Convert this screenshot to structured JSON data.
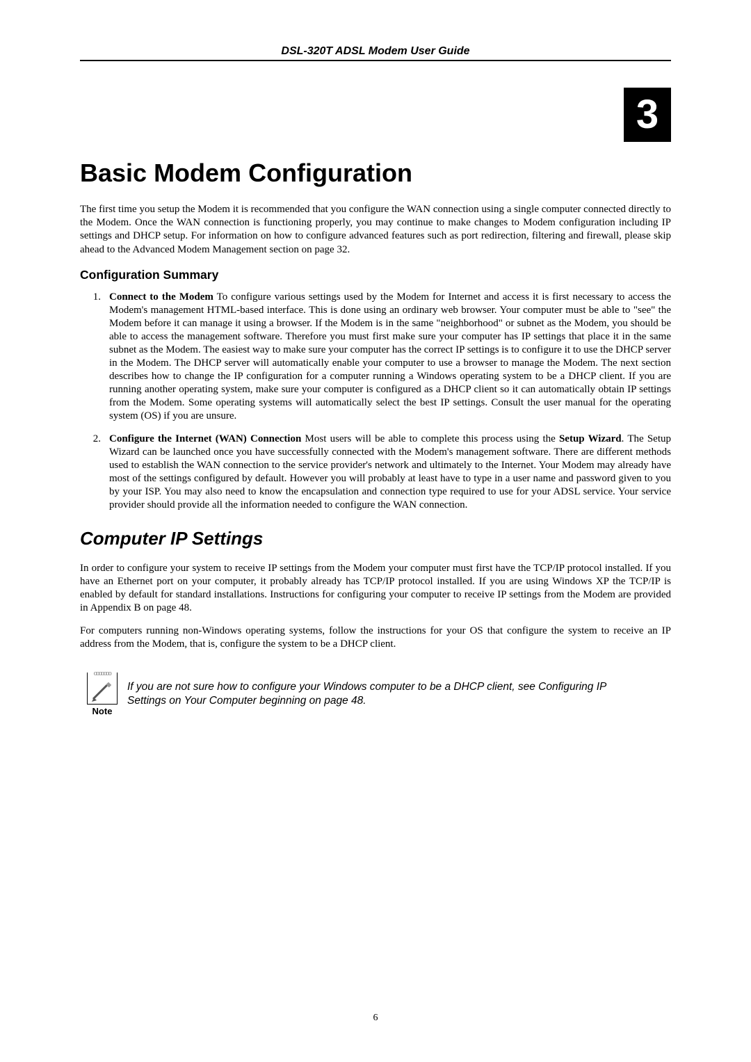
{
  "header": {
    "title": "DSL-320T ADSL Modem User Guide"
  },
  "chapter": {
    "number": "3",
    "heading": "Basic Modem Configuration",
    "intro": "The first time you setup the Modem it is recommended that you configure the WAN connection using a single computer connected directly to the Modem. Once the WAN connection is functioning properly, you may continue to make changes to Modem configuration including IP settings and DHCP setup. For information on how to configure advanced features such as port redirection, filtering and firewall, please skip ahead to the Advanced Modem Management section on page 32."
  },
  "config_summary": {
    "heading": "Configuration Summary",
    "items": [
      {
        "num": "1.",
        "bold_lead": "Connect to the Modem",
        "text": " To configure various settings used by the Modem for Internet and access it is first necessary to access the Modem's management HTML-based interface. This is done using an ordinary web browser. Your computer must be able to \"see\" the Modem before it can manage it using a browser. If the Modem is in the same \"neighborhood\" or subnet as the Modem, you should be able to access the management software. Therefore you must first make sure your computer has IP settings that place it in the same subnet as the Modem. The easiest way to make sure your computer has the correct IP settings is to configure it to use the DHCP server in the Modem. The DHCP server will automatically enable your computer to use a browser to manage the Modem. The next section describes how to change the IP configuration for a computer running a Windows operating system to be a DHCP client. If you are running another operating system, make sure your computer is configured as a DHCP client so it can automatically obtain IP settings from the Modem. Some operating systems will automatically select the best IP settings. Consult the user manual for the operating system (OS) if you are unsure."
      },
      {
        "num": "2.",
        "bold_lead": "Configure the Internet (WAN) Connection",
        "text_before_wizard": " Most users will be able to complete this process using the ",
        "bold_wizard": "Setup Wizard",
        "text_after_wizard": ". The Setup Wizard can be launched once you have successfully connected with the Modem's management software. There are different methods used to establish the WAN connection to the service provider's network and ultimately to the Internet. Your Modem may already have most of the settings configured by default. However you will probably at least have to type in a user name and password given to you by your ISP. You may also need to know the encapsulation and connection type required to use for your ADSL service. Your service provider should provide all the information needed to configure the WAN connection."
      }
    ]
  },
  "ip_settings": {
    "heading": "Computer IP Settings",
    "para1": "In order to configure your system to receive IP settings from the Modem your computer must first have the TCP/IP protocol installed. If you have an Ethernet port on your computer, it probably already has TCP/IP protocol installed. If you are using Windows XP the TCP/IP is enabled by default for standard installations. Instructions for configuring your computer to receive IP settings from the Modem are provided in Appendix B on page 48.",
    "para2": "For computers running non-Windows operating systems, follow the instructions for your OS that configure the system to receive an IP address from the Modem, that is, configure the system to be a DHCP client."
  },
  "note": {
    "label": "Note",
    "text": "If you are not sure how to configure your Windows computer to be a DHCP client, see Configuring IP Settings on Your Computer beginning on page 48."
  },
  "footer": {
    "page_number": "6"
  }
}
